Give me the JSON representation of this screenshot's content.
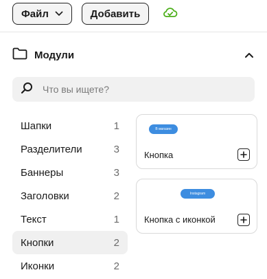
{
  "toolbar": {
    "file_label": "Файл",
    "add_label": "Добавить"
  },
  "modules": {
    "title": "Модули"
  },
  "search": {
    "placeholder": "Что вы ищете?"
  },
  "categories": [
    {
      "label": "Шапки",
      "count": "1"
    },
    {
      "label": "Разделители",
      "count": "3"
    },
    {
      "label": "Баннеры",
      "count": "3"
    },
    {
      "label": "Заголовки",
      "count": "2"
    },
    {
      "label": "Текст",
      "count": "1"
    },
    {
      "label": "Кнопки",
      "count": "2"
    },
    {
      "label": "Иконки",
      "count": "2"
    }
  ],
  "active_category": "Кнопки",
  "cards": [
    {
      "label": "Кнопка",
      "preview_text": "В магазин"
    },
    {
      "label": "Кнопка с иконкой",
      "preview_text": "Instagram"
    }
  ],
  "colors": {
    "cloud_ok": "#4caf1a",
    "preview_button": "#3d8de0"
  }
}
